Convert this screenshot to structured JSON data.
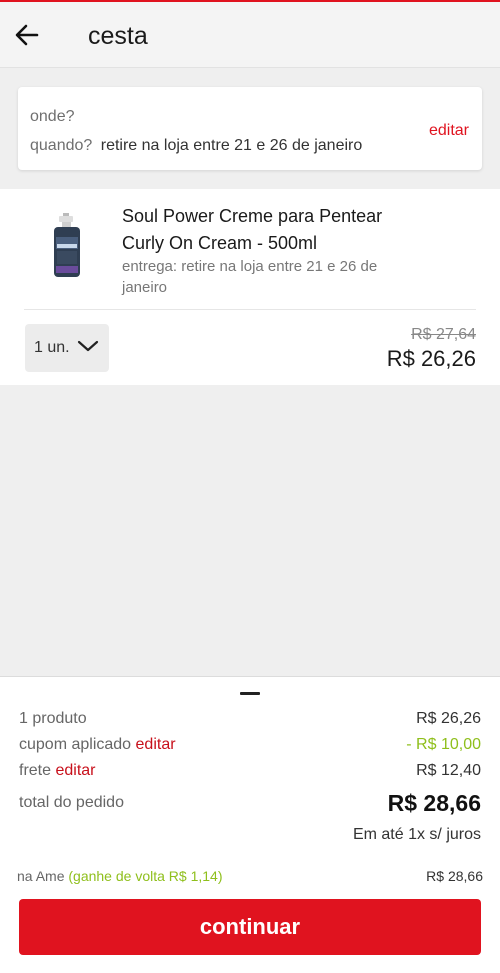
{
  "header": {
    "title": "cesta",
    "back_icon": "arrow-left-icon"
  },
  "location": {
    "where_label": "onde?",
    "when_label": "quando?",
    "when_value": "retire na loja entre 21 e 26 de janeiro",
    "edit_label": "editar"
  },
  "product": {
    "image_icon": "product-bottle-image",
    "name": "Soul Power Creme para Pentear Curly On Cream - 500ml",
    "delivery": "entrega: retire na loja entre 21 e 26 de janeiro",
    "quantity": "1 un.",
    "price_old": "R$ 27,64",
    "price_new": "R$ 26,26"
  },
  "summary": {
    "products_label": "1 produto",
    "products_value": "R$ 26,26",
    "coupon_label": "cupom aplicado",
    "coupon_edit": "editar",
    "coupon_value": "- R$ 10,00",
    "shipping_label": "frete",
    "shipping_edit": "editar",
    "shipping_value": "R$ 12,40",
    "total_label": "total do pedido",
    "total_value": "R$ 28,66",
    "installments": "Em até 1x s/ juros",
    "ame_label": "na Ame",
    "ame_cashback": "(ganhe de volta R$ 1,14)",
    "ame_value": "R$ 28,66",
    "continue_label": "continuar"
  },
  "colors": {
    "brand_red": "#e0131f",
    "edit_red": "#c8101b",
    "discount_green": "#8fbf1c"
  }
}
